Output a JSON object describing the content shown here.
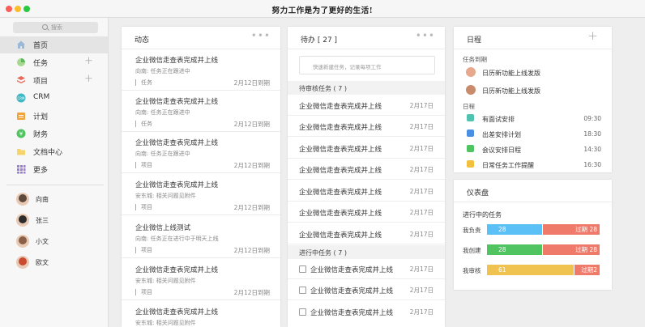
{
  "app": {
    "title": "努力工作是为了更好的生活!"
  },
  "colors": {
    "accent_blue": "#5bc0f6",
    "accent_green": "#4fc460",
    "accent_yellow": "#f0c350",
    "overdue_red": "#f07a6a"
  },
  "sidebar": {
    "search_placeholder": "搜索",
    "items": [
      {
        "label": "首页",
        "icon": "home-icon"
      },
      {
        "label": "任务",
        "icon": "task-pie-icon"
      },
      {
        "label": "项目",
        "icon": "project-layers-icon"
      },
      {
        "label": "CRM",
        "icon": "crm-icon"
      },
      {
        "label": "计划",
        "icon": "plan-calendar-icon"
      },
      {
        "label": "财务",
        "icon": "finance-coin-icon"
      },
      {
        "label": "文档中心",
        "icon": "folder-icon"
      },
      {
        "label": "更多",
        "icon": "grid-icon"
      }
    ],
    "members": [
      {
        "name": "向南"
      },
      {
        "name": "张三"
      },
      {
        "name": "小文"
      },
      {
        "name": "欧文"
      }
    ]
  },
  "activity": {
    "title": "动态",
    "cards": [
      {
        "title": "企业微信走查表完成并上线",
        "sub": "向南: 任务正在跟进中",
        "tag": "任务",
        "due": "2月12日到期"
      },
      {
        "title": "企业微信走查表完成并上线",
        "sub": "向南: 任务正在跟进中",
        "tag": "任务",
        "due": "2月12日到期"
      },
      {
        "title": "企业微信走查表完成并上线",
        "sub": "向南: 任务正在跟进中",
        "tag": "项目",
        "due": "2月12日到期"
      },
      {
        "title": "企业微信走查表完成并上线",
        "sub": "安东城: 相关问题见附件",
        "tag": "项目",
        "due": "2月12日到期"
      },
      {
        "title": "企业微信上线测试",
        "sub": "向南: 任务正在进行中于明天上线",
        "tag": "项目",
        "due": "2月12日到期"
      },
      {
        "title": "企业微信走查表完成并上线",
        "sub": "安东城: 相关问题见附件",
        "tag": "项目",
        "due": "2月12日到期"
      },
      {
        "title": "企业微信走查表完成并上线",
        "sub": "安东城: 相关问题见附件",
        "tag": "",
        "due": ""
      }
    ]
  },
  "todo": {
    "title": "待办 [ 27 ]",
    "quick_placeholder": "快速新建任务，记录每项工作",
    "pending_title": "待审核任务 ( 7 )",
    "pending": [
      {
        "text": "企业微信走查表完成并上线",
        "date": "2月17日"
      },
      {
        "text": "企业微信走查表完成并上线",
        "date": "2月17日"
      },
      {
        "text": "企业微信走查表完成并上线",
        "date": "2月17日"
      },
      {
        "text": "企业微信走查表完成并上线",
        "date": "2月17日"
      },
      {
        "text": "企业微信走查表完成并上线",
        "date": "2月17日"
      },
      {
        "text": "企业微信走查表完成并上线",
        "date": "2月17日"
      },
      {
        "text": "企业微信走查表完成并上线",
        "date": "2月17日"
      }
    ],
    "inprogress_title": "进行中任务 ( 7 )",
    "inprogress": [
      {
        "text": "企业微信走查表完成并上线",
        "date": "2月17日"
      },
      {
        "text": "企业微信走查表完成并上线",
        "date": "2月17日"
      },
      {
        "text": "企业微信走查表完成并上线",
        "date": "2月17日"
      }
    ]
  },
  "schedule": {
    "title": "日程",
    "due_title": "任务到期",
    "due_items": [
      {
        "text": "日历新功能上线发版"
      },
      {
        "text": "日历新功能上线发版"
      }
    ],
    "sched_title": "日程",
    "items": [
      {
        "text": "有面试安排",
        "time": "09:30",
        "color": "#4fc3b0"
      },
      {
        "text": "出差安排计划",
        "time": "18:30",
        "color": "#4a90e2"
      },
      {
        "text": "会议安排日程",
        "time": "14:30",
        "color": "#4fc460"
      },
      {
        "text": "日常任务工作提醒",
        "time": "16:30",
        "color": "#f3c03d"
      }
    ]
  },
  "dashboard": {
    "title": "仪表盘",
    "sub": "进行中的任务",
    "bars": [
      {
        "label": "我负责",
        "value": "28",
        "overdue": "过期 28",
        "color": "#5bc0f6"
      },
      {
        "label": "我创建",
        "value": "28",
        "overdue": "过期 28",
        "color": "#4fc460"
      },
      {
        "label": "我审核",
        "value": "61",
        "overdue": "过期2",
        "color": "#f0c350"
      }
    ]
  }
}
